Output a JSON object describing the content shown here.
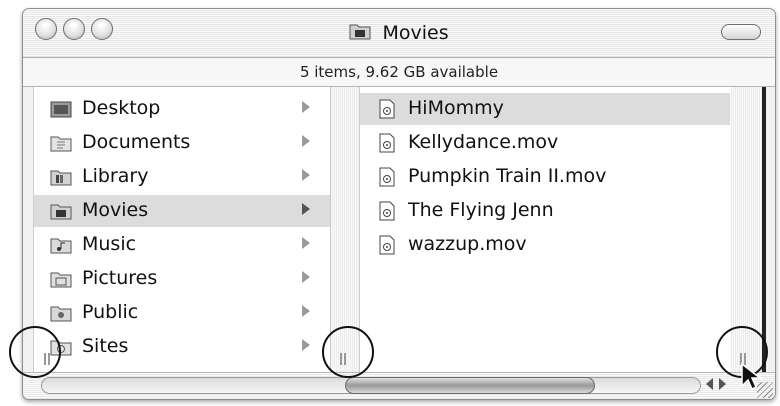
{
  "window": {
    "title": "Movies",
    "title_icon": "folder-movies-icon"
  },
  "status": {
    "text": "5 items, 9.62 GB available"
  },
  "column1": {
    "items": [
      {
        "label": "Desktop",
        "icon": "desktop-folder-icon",
        "selected": false
      },
      {
        "label": "Documents",
        "icon": "documents-folder-icon",
        "selected": false
      },
      {
        "label": "Library",
        "icon": "library-folder-icon",
        "selected": false
      },
      {
        "label": "Movies",
        "icon": "movies-folder-icon",
        "selected": true
      },
      {
        "label": "Music",
        "icon": "music-folder-icon",
        "selected": false
      },
      {
        "label": "Pictures",
        "icon": "pictures-folder-icon",
        "selected": false
      },
      {
        "label": "Public",
        "icon": "public-folder-icon",
        "selected": false
      },
      {
        "label": "Sites",
        "icon": "sites-folder-icon",
        "selected": false
      }
    ]
  },
  "column2": {
    "items": [
      {
        "label": "HiMommy",
        "icon": "movie-file-icon",
        "selected": true
      },
      {
        "label": "Kellydance.mov",
        "icon": "movie-file-icon",
        "selected": false
      },
      {
        "label": "Pumpkin Train II.mov",
        "icon": "movie-file-icon",
        "selected": false
      },
      {
        "label": "The Flying Jenn",
        "icon": "movie-file-icon",
        "selected": false
      },
      {
        "label": "wazzup.mov",
        "icon": "movie-file-icon",
        "selected": false
      }
    ]
  },
  "colors": {
    "selection": "#dcdcdc",
    "annotation_circle": "#111111"
  }
}
